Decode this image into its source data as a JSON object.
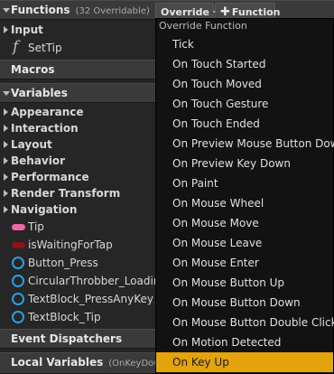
{
  "functions": {
    "title": "Functions",
    "subtitle": "(32 Overridable)",
    "override_label": "Override",
    "add_function_label": "Function",
    "items": [
      {
        "label": "Input",
        "type": "category"
      },
      {
        "label": "SetTip",
        "type": "function",
        "icon": "function-icon"
      }
    ]
  },
  "macros": {
    "title": "Macros"
  },
  "variables": {
    "title": "Variables",
    "categories": [
      "Appearance",
      "Interaction",
      "Layout",
      "Behavior",
      "Performance",
      "Render Transform",
      "Navigation"
    ],
    "items": [
      {
        "label": "Tip",
        "icon": "pill-icon",
        "color": "#e86aa6"
      },
      {
        "label": "isWaitingForTap",
        "icon": "pill-icon",
        "color": "#8e1212"
      },
      {
        "label": "Button_Press",
        "icon": "ring-icon",
        "color": "#2a9de3"
      },
      {
        "label": "CircularThrobber_Loading",
        "icon": "ring-icon",
        "color": "#2a9de3"
      },
      {
        "label": "TextBlock_PressAnyKey",
        "icon": "ring-icon",
        "color": "#2a9de3"
      },
      {
        "label": "TextBlock_Tip",
        "icon": "ring-icon",
        "color": "#2a9de3"
      }
    ]
  },
  "event_dispatchers": {
    "title": "Event Dispatchers"
  },
  "local_variables": {
    "title": "Local Variables",
    "subtitle": "(OnKeyDown)"
  },
  "override_menu": {
    "header": "Override Function",
    "selected_index": 16,
    "accent_color": "#e3a30c",
    "items": [
      "Tick",
      "On Touch Started",
      "On Touch Moved",
      "On Touch Gesture",
      "On Touch Ended",
      "On Preview Mouse Button Down",
      "On Preview Key Down",
      "On Paint",
      "On Mouse Wheel",
      "On Mouse Move",
      "On Mouse Leave",
      "On Mouse Enter",
      "On Mouse Button Up",
      "On Mouse Button Down",
      "On Mouse Button Double Click",
      "On Motion Detected",
      "On Key Up"
    ]
  }
}
